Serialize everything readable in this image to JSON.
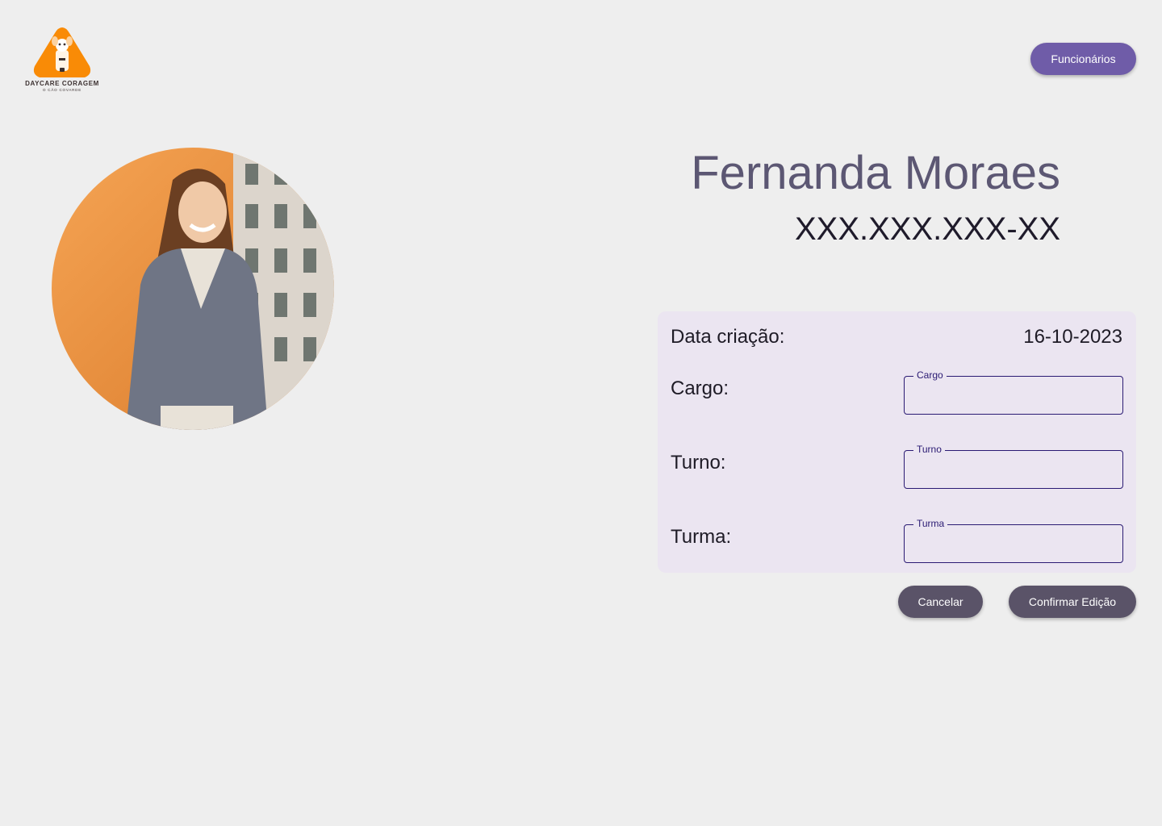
{
  "logo": {
    "brand": "DAYCARE CORAGEM",
    "tagline": "O CÃO COVARDE",
    "accent": "#f98b06"
  },
  "nav": {
    "employees_label": "Funcionários",
    "color": "#6f5ca8"
  },
  "profile": {
    "name": "Fernanda Moraes",
    "cpf": "XXX.XXX.XXX-XX",
    "photo_icon": "employee-photo"
  },
  "details": {
    "created_label": "Data criação:",
    "created_value": "16-10-2023",
    "cargo_label": "Cargo:",
    "cargo_field_label": "Cargo",
    "cargo_value": "",
    "turno_label": "Turno:",
    "turno_field_label": "Turno",
    "turno_value": "",
    "turma_label": "Turma:",
    "turma_field_label": "Turma",
    "turma_value": ""
  },
  "actions": {
    "cancel_label": "Cancelar",
    "confirm_label": "Confirmar Edição",
    "color": "#5a5368"
  }
}
